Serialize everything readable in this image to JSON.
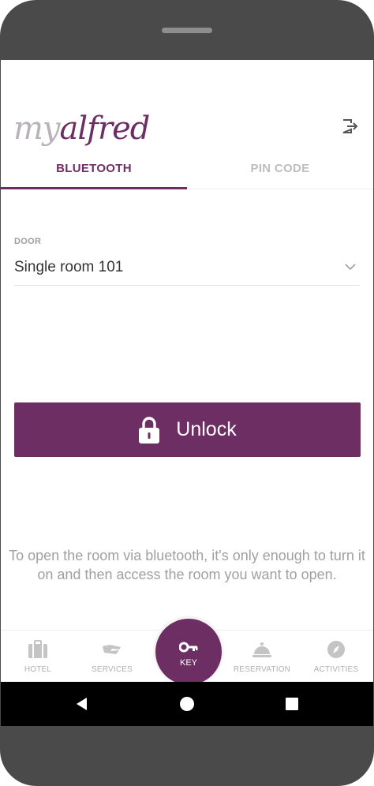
{
  "app": {
    "logo_my": "my",
    "logo_alfred": "alfred"
  },
  "header": {
    "logout_icon": "logout-icon"
  },
  "tabs": [
    {
      "label": "BLUETOOTH",
      "active": true
    },
    {
      "label": "PIN CODE",
      "active": false
    }
  ],
  "door": {
    "label": "DOOR",
    "value": "Single room 101"
  },
  "unlock_button": {
    "label": "Unlock",
    "icon": "lock-icon"
  },
  "hint": "To open the room via bluetooth, it's only enough to turn it on and then access the room you want to open.",
  "bottom_nav": [
    {
      "label": "HOTEL",
      "icon": "suitcase-icon"
    },
    {
      "label": "SERVICES",
      "icon": "hand-icon"
    },
    {
      "label": "KEY",
      "icon": "key-icon",
      "active": true
    },
    {
      "label": "RESERVATION",
      "icon": "bell-icon"
    },
    {
      "label": "ACTIVITIES",
      "icon": "compass-icon"
    }
  ],
  "colors": {
    "brand": "#6d2f63",
    "inactive": "#bdbdbd"
  }
}
